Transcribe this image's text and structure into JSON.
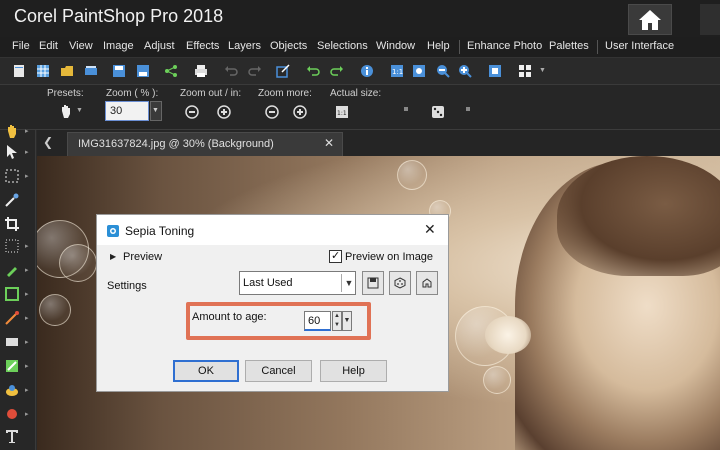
{
  "app": {
    "title": "Corel PaintShop Pro 2018"
  },
  "menu": [
    "File",
    "Edit",
    "View",
    "Image",
    "Adjust",
    "Effects",
    "Layers",
    "Objects",
    "Selections",
    "Window",
    "Help",
    "Enhance Photo",
    "Palettes",
    "User Interface"
  ],
  "options": {
    "presets_label": "Presets:",
    "zoom_label": "Zoom ( % ):",
    "zoom_value": "30",
    "zoom_out_label": "Zoom out / in:",
    "zoom_more_label": "Zoom more:",
    "actual_size_label": "Actual size:"
  },
  "document_tab": {
    "label": "IMG31637824.jpg @  30% (Background)",
    "close": "✕"
  },
  "dialog": {
    "title": "Sepia Toning",
    "close": "✕",
    "preview_label": "Preview",
    "preview_on_image_label": "Preview on Image",
    "preview_on_image_checked": true,
    "settings_label": "Settings",
    "preset_value": "Last Used",
    "amount_label": "Amount to age:",
    "amount_value": "60",
    "buttons": {
      "ok": "OK",
      "cancel": "Cancel",
      "help": "Help"
    }
  },
  "colors": {
    "accent_highlight": "#e07255",
    "focus_blue": "#2f6fd1",
    "chrome_dark": "#1f1f1f"
  }
}
